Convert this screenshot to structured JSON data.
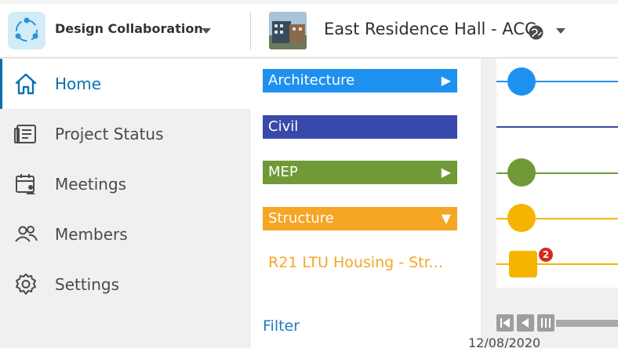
{
  "header": {
    "app_name": "Design Collaboration",
    "project_name": "East Residence Hall - ACC"
  },
  "sidebar": {
    "items": [
      {
        "label": "Home",
        "icon": "home-icon",
        "active": true
      },
      {
        "label": "Project Status",
        "icon": "project-status-icon",
        "active": false
      },
      {
        "label": "Meetings",
        "icon": "calendar-icon",
        "active": false
      },
      {
        "label": "Members",
        "icon": "members-icon",
        "active": false
      },
      {
        "label": "Settings",
        "icon": "gear-icon",
        "active": false
      }
    ]
  },
  "disciplines": [
    {
      "label": "Architecture",
      "color": "#1e90f0",
      "arrow": "▶"
    },
    {
      "label": "Civil",
      "color": "#3949ab",
      "arrow": ""
    },
    {
      "label": "MEP",
      "color": "#6f9a37",
      "arrow": "▶"
    },
    {
      "label": "Structure",
      "color": "#f5a623",
      "arrow": "▼"
    }
  ],
  "sub_item": "R21 LTU Housing - Str...",
  "filter_label": "Filter",
  "timeline": {
    "date": "12/08/2020",
    "badge_count": "2",
    "colors": {
      "architecture": "#1e90f0",
      "civil": "#3949ab",
      "mep": "#6f9a37",
      "structure": "#f5b400",
      "badge": "#d42b1f"
    }
  }
}
